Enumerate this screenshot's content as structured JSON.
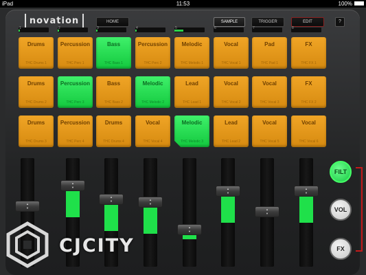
{
  "status_bar": {
    "carrier": "iPad",
    "time": "11:53",
    "battery": "100%"
  },
  "app": {
    "logo_text": "novation"
  },
  "nav": {
    "home": "HOME",
    "sample": "SAMPLE",
    "trigger": "TRIGGER",
    "edit": "EDIT",
    "help": "?"
  },
  "channels": [
    {
      "num": "1",
      "level": 0.05
    },
    {
      "num": "2",
      "level": 0.05
    },
    {
      "num": "3",
      "level": 0.05
    },
    {
      "num": "4",
      "level": 0.05
    },
    {
      "num": "5",
      "level": 0.3
    },
    {
      "num": "6",
      "level": 0
    },
    {
      "num": "7",
      "level": 0
    },
    {
      "num": "8",
      "level": 0
    }
  ],
  "pads": [
    [
      {
        "label": "Drums",
        "sub": "THC Drums 1",
        "active": false
      },
      {
        "label": "Percussion",
        "sub": "THC Perc 1",
        "active": false
      },
      {
        "label": "Bass",
        "sub": "THC Bass 1",
        "active": true
      },
      {
        "label": "Percussion",
        "sub": "THC Perc 2",
        "active": false
      },
      {
        "label": "Melodic",
        "sub": "THC Melodic 1",
        "active": false
      },
      {
        "label": "Vocal",
        "sub": "THC Vocal 1",
        "active": false
      },
      {
        "label": "Pad",
        "sub": "THC Pad 1",
        "active": false
      },
      {
        "label": "FX",
        "sub": "THC FX 1",
        "active": false
      }
    ],
    [
      {
        "label": "Drums",
        "sub": "THC Drums 2",
        "active": false
      },
      {
        "label": "Percussion",
        "sub": "THC Perc 3",
        "active": true
      },
      {
        "label": "Bass",
        "sub": "THC Bass 2",
        "active": false
      },
      {
        "label": "Melodic",
        "sub": "THC Melodic 2",
        "active": true
      },
      {
        "label": "Lead",
        "sub": "THC Lead 1",
        "active": false
      },
      {
        "label": "Vocal",
        "sub": "THC Vocal 2",
        "active": false
      },
      {
        "label": "Vocal",
        "sub": "THC Vocal 3",
        "active": false
      },
      {
        "label": "FX",
        "sub": "THC FX 2",
        "active": false
      }
    ],
    [
      {
        "label": "Drums",
        "sub": "THC Drums 3",
        "active": false
      },
      {
        "label": "Percussion",
        "sub": "THC Perc 4",
        "active": false
      },
      {
        "label": "Drums",
        "sub": "THC Drums 4",
        "active": false
      },
      {
        "label": "Vocal",
        "sub": "THC Vocal 4",
        "active": false
      },
      {
        "label": "Melodic",
        "sub": "THC Melodic 3",
        "active": true,
        "cut": true
      },
      {
        "label": "Lead",
        "sub": "THC Lead 2",
        "active": false
      },
      {
        "label": "Vocal",
        "sub": "THC Vocal 5",
        "active": false
      },
      {
        "label": "Vocal",
        "sub": "THC Vocal 6",
        "active": false
      }
    ]
  ],
  "faders": [
    {
      "value": 0.58,
      "fill": false
    },
    {
      "value": 0.8,
      "fill": true
    },
    {
      "value": 0.65,
      "fill": true
    },
    {
      "value": 0.62,
      "fill": true
    },
    {
      "value": 0.33,
      "fill": true
    },
    {
      "value": 0.74,
      "fill": true
    },
    {
      "value": 0.52,
      "fill": false
    },
    {
      "value": 0.74,
      "fill": true
    }
  ],
  "modes": {
    "filter": "FILT",
    "volume": "VOL",
    "fx": "FX"
  },
  "watermark": {
    "text": "CJCITY"
  },
  "colors": {
    "pad_off": "#f0a526",
    "pad_on": "#2be052",
    "fader_fill": "#1fe04a",
    "mode_accent": "#c41a1a"
  }
}
